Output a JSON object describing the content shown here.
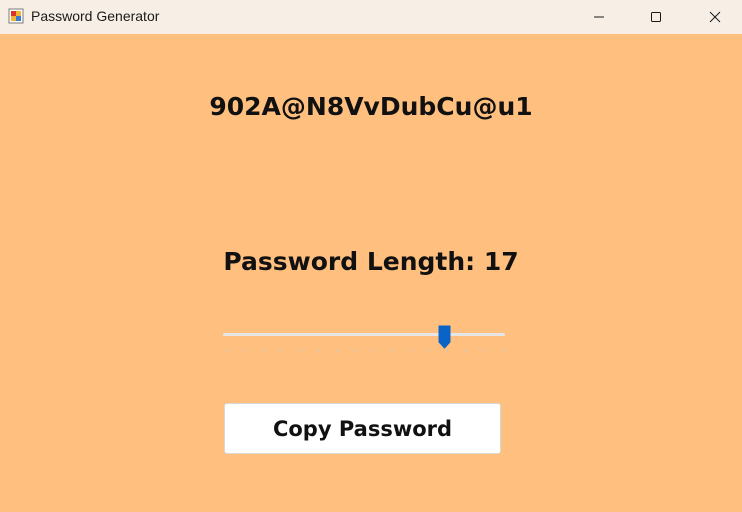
{
  "window": {
    "title": "Password Generator",
    "icon": "app-icon"
  },
  "password": {
    "value": "902A@N8VvDubCu@u1"
  },
  "length": {
    "label": "Password Length: 17",
    "value": 17,
    "fraction": 0.79
  },
  "copy_button": {
    "label": "Copy Password"
  },
  "colors": {
    "background": "#ffbf7f",
    "accent": "#0a64c8"
  }
}
